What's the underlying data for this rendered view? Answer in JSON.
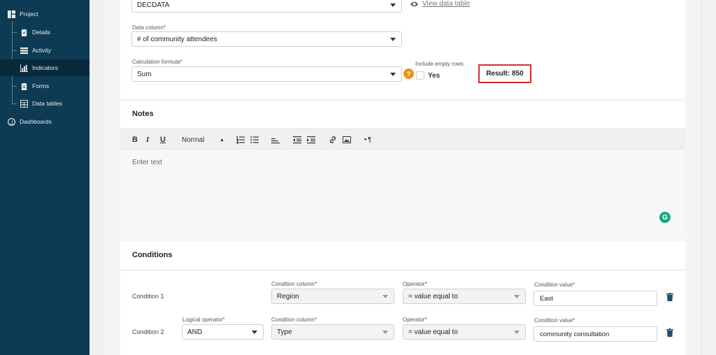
{
  "sidebar": {
    "items": [
      {
        "label": "Project",
        "icon": "dashboard-layout-icon"
      },
      {
        "label": "Details",
        "icon": "clipboard-icon"
      },
      {
        "label": "Activity",
        "icon": "activity-list-icon"
      },
      {
        "label": "Indicators",
        "icon": "bar-chart-icon"
      },
      {
        "label": "Forms",
        "icon": "form-clipboard-icon"
      },
      {
        "label": "Data tables",
        "icon": "table-icon"
      },
      {
        "label": "Dashboards",
        "icon": "gauge-icon"
      }
    ],
    "active": "Indicators",
    "background": "#0d3b53"
  },
  "indicator_form": {
    "data_table_value": "DECDATA",
    "view_data_table_link": "View data table",
    "data_column_label": "Data column*",
    "data_column_value": "# of community attendees",
    "calc_formula_label": "Calculation formula*",
    "calc_formula_value": "Sum",
    "help_icon_text": "?",
    "include_empty_rows_label": "Include empty rows",
    "include_empty_rows_option": "Yes",
    "include_empty_rows_checked": false,
    "result_text": "Result: 850"
  },
  "notes": {
    "title": "Notes",
    "toolbar": {
      "bold": "B",
      "italic": "I",
      "underline": "U",
      "text_style": "Normal"
    },
    "placeholder": "Enter text",
    "grammarly_badge": "G"
  },
  "conditions": {
    "title": "Conditions",
    "rows": [
      {
        "label": "Condition 1",
        "logical_operator_label": "",
        "logical_operator_value": "",
        "column_label": "Condition column*",
        "column_value": "Region",
        "operator_label": "Operator*",
        "operator_value": "= value equal to",
        "value_label": "Condition value*",
        "value": "East"
      },
      {
        "label": "Condition 2",
        "logical_operator_label": "Logical operator*",
        "logical_operator_value": "AND",
        "column_label": "Condition column*",
        "column_value": "Type",
        "operator_label": "Operator*",
        "operator_value": "= value equal to",
        "value_label": "Condition value*",
        "value": "community consultation"
      }
    ]
  },
  "colors": {
    "accent_result_border": "#d32f2f",
    "help_icon": "#f0931a",
    "grammarly": "#15a880"
  }
}
